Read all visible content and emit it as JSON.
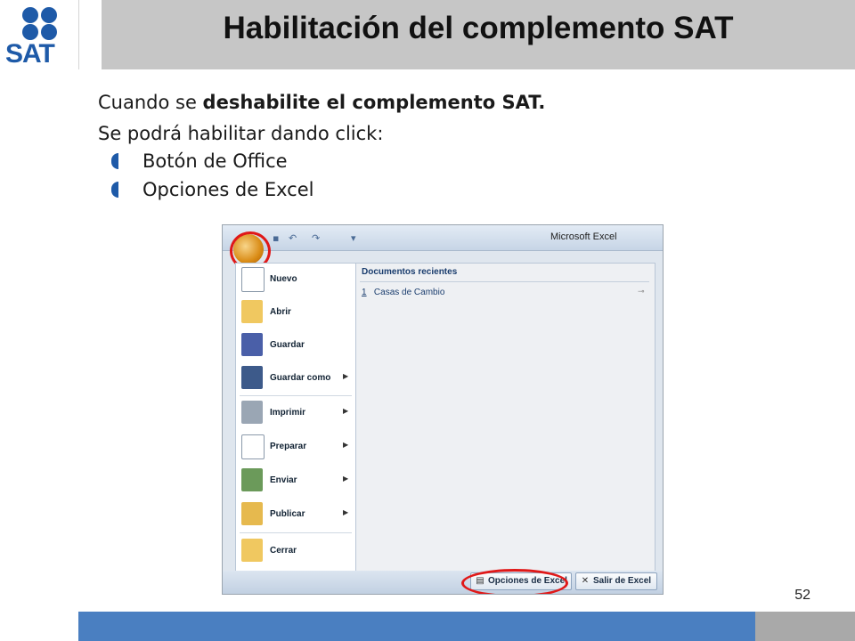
{
  "logo": {
    "text": "SAT",
    "color": "#1e5aa8"
  },
  "header": {
    "title": "Habilitación del complemento SAT"
  },
  "body": {
    "line1_prefix": "Cuando se ",
    "line1_bold": "deshabilite el complemento SAT.",
    "line2": "Se podrá habilitar dando click:",
    "bullets": [
      "Botón de Office",
      "Opciones de Excel"
    ]
  },
  "screenshot": {
    "app_title": "Microsoft Excel",
    "recent_header": "Documentos recientes",
    "recent_items": [
      {
        "number": "1",
        "name": "Casas de Cambio"
      }
    ],
    "menu_items": [
      {
        "label": "Nuevo",
        "has_submenu": false
      },
      {
        "label": "Abrir",
        "has_submenu": false
      },
      {
        "label": "Guardar",
        "has_submenu": false
      },
      {
        "label": "Guardar como",
        "has_submenu": true
      },
      {
        "label": "Imprimir",
        "has_submenu": true
      },
      {
        "label": "Preparar",
        "has_submenu": true
      },
      {
        "label": "Enviar",
        "has_submenu": true
      },
      {
        "label": "Publicar",
        "has_submenu": true
      },
      {
        "label": "Cerrar",
        "has_submenu": false
      }
    ],
    "options_button": "Opciones de Excel",
    "exit_button": "Salir de Excel",
    "highlight_color": "#e01818"
  },
  "footer": {
    "page_number": "52"
  },
  "colors": {
    "band": "#4a7fc1",
    "header_band": "#c6c6c6"
  }
}
